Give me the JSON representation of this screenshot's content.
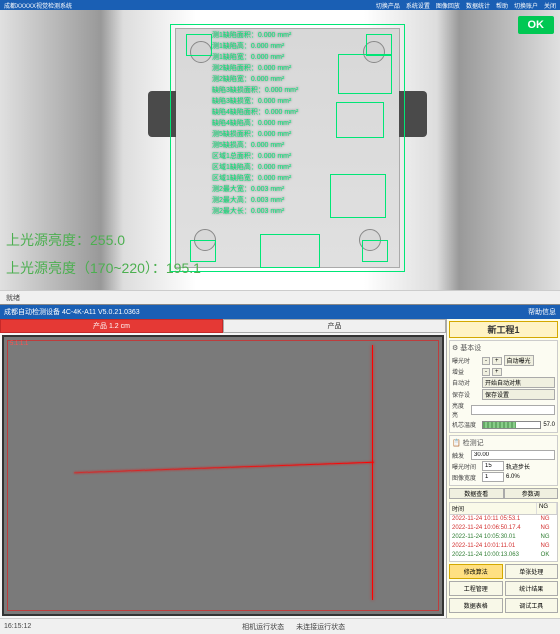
{
  "top": {
    "title_left": "成都XXXXX视觉检测系统",
    "menu": [
      "切换产品",
      "系统设置",
      "图像回放",
      "数据统计",
      "帮助"
    ],
    "menu_right": [
      "切换账户",
      "关闭"
    ],
    "ok": "OK",
    "brightness1": "上光源亮度：255.0",
    "brightness2": "上光源亮度（170~220）：195.1",
    "measurements": [
      "测1缺陷面积：0.000 mm²",
      "测1缺陷高：0.000 mm²",
      "测1缺陷宽：0.000 mm²",
      "测2缺陷面积：0.000 mm²",
      "测2缺陷宽：0.000 mm²",
      "缺陷3缺损面积：0.000 mm²",
      "缺陷3缺损宽：0.000 mm²",
      "缺陷4缺陷面积：0.000 mm²",
      "缺陷4缺陷高：0.000 mm²",
      "测5缺损面积：0.000 mm²",
      "测5缺损高：0.000 mm²",
      "区域1总面积：0.000 mm²",
      "区域1缺陷高：0.000 mm²",
      "区域1缺陷宽：0.000 mm²",
      "测2最大宽：0.003 mm²",
      "测2最大高：0.003 mm²",
      "测2最大长：0.003 mm²"
    ],
    "status": "就绪"
  },
  "bot": {
    "title": "成都自动检测设备 4C-4K-A11 V5.0.21.0363",
    "title_right": "帮助信息",
    "tabs": [
      {
        "label": "产品",
        "sub": "1.2 cm",
        "active": true
      },
      {
        "label": "产品",
        "sub": "",
        "active": false
      }
    ],
    "red_label": "5.1:1.1",
    "panel": {
      "title": "新工程1",
      "groups": {
        "basic": {
          "h": "⚙ 基本设",
          "rows": [
            {
              "lbl": "曝光时",
              "btns": [
                "-",
                "+"
              ],
              "val": "",
              "after": [
                "自动曝光"
              ]
            },
            {
              "lbl": "增益",
              "btns": [
                "-",
                "+"
              ],
              "val": ""
            },
            {
              "lbl": "自动对",
              "btn": "开始自动对焦"
            },
            {
              "lbl": "保存设",
              "btn": "保存设置"
            },
            {
              "lbl": "亮度亮",
              "val": ""
            }
          ]
        },
        "temp": {
          "lbl": "机芯温度",
          "pct": 57,
          "txt": "57.0"
        },
        "record": {
          "h": "📋 检测记",
          "rows": [
            {
              "lbl": "触发",
              "val": "30.00"
            },
            {
              "lbl": "曝光时间",
              "v1": "15",
              "v2": "轨迹步长"
            },
            {
              "lbl": "图像宽度",
              "v1": "1",
              "v2": "6.0%"
            }
          ]
        },
        "tabs2": [
          "数据查看",
          "参数调"
        ],
        "log": {
          "head": [
            "时间",
            "NG"
          ],
          "rows": [
            {
              "t": "2022-11-24 10:11 05:53.1",
              "r": "NG",
              "c": "red"
            },
            {
              "t": "2022-11-24 10:06:50.17.4",
              "r": "NG",
              "c": "red"
            },
            {
              "t": "2022-11-24 10:05:30.01",
              "r": "NG",
              "c": "gr"
            },
            {
              "t": "2022-11-24 10:01:11.01",
              "r": "NG",
              "c": "red"
            },
            {
              "t": "2022-11-24 10:00:13.063",
              "r": "OK",
              "c": "gr"
            }
          ]
        },
        "buttons": [
          "修改算法",
          "单张处理",
          "工程管理",
          "统计结果",
          "数据表格",
          "调试工具"
        ]
      }
    },
    "status": {
      "time": "16:15:12",
      "mid1": "相机运行状态",
      "mid2": "未连接运行状态"
    }
  }
}
